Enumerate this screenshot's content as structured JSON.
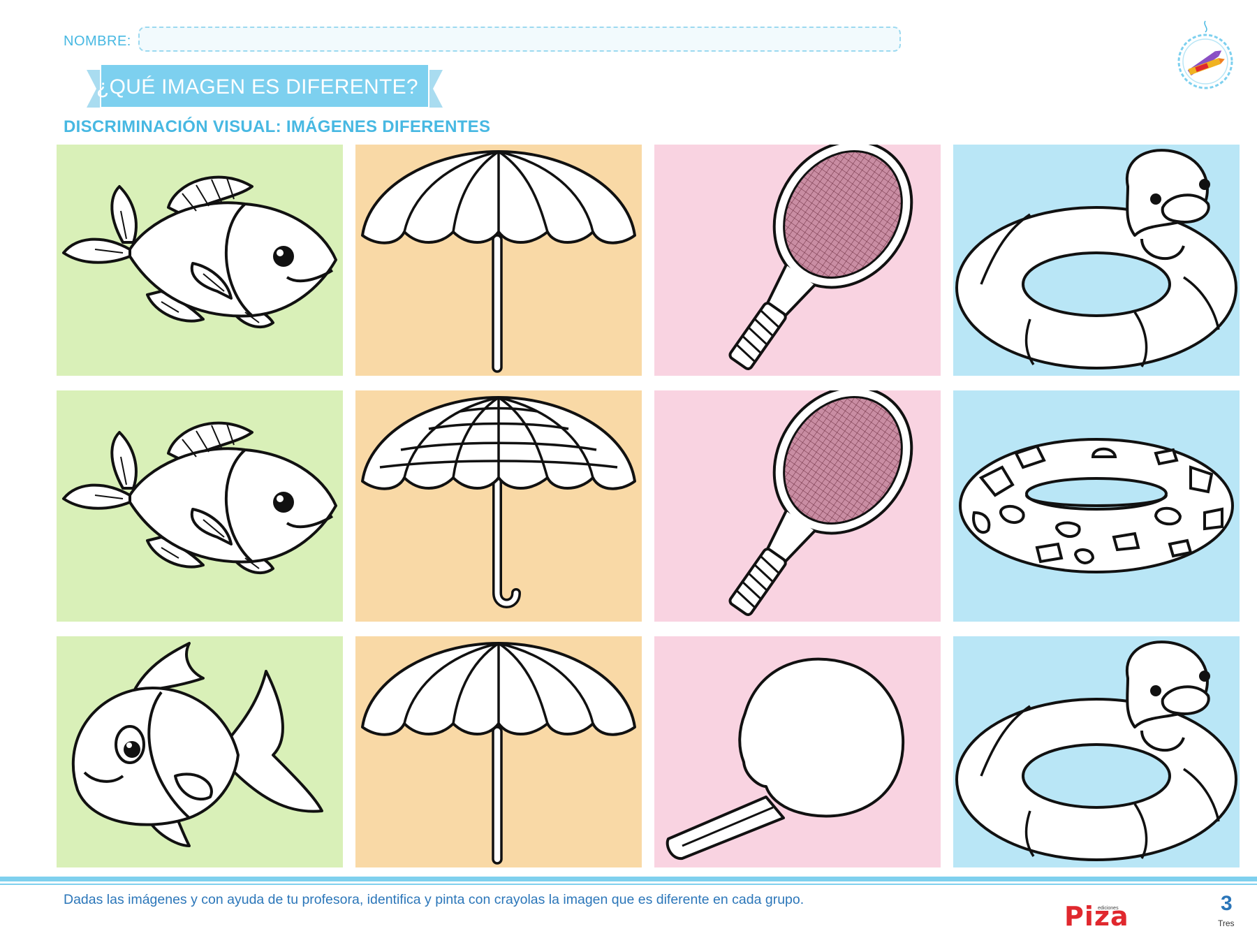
{
  "header": {
    "name_label": "NOMBRE:",
    "title": "¿QUÉ IMAGEN ES DIFERENTE?",
    "subtitle": "DISCRIMINACIÓN VISUAL: IMÁGENES DIFERENTES",
    "badge_icon": "crayon-icon"
  },
  "grid": {
    "rows": [
      [
        "fish-right",
        "umbrella-plain",
        "tennis-racket",
        "duck-float"
      ],
      [
        "fish-right",
        "umbrella-striped",
        "tennis-racket",
        "spotted-float"
      ],
      [
        "fish-left",
        "umbrella-plain",
        "pingpong-paddle",
        "duck-float"
      ]
    ],
    "column_colors": [
      "#d9f0b8",
      "#f9d9a6",
      "#f9d3e1",
      "#b9e6f6"
    ]
  },
  "footer": {
    "instruction": "Dadas las imágenes y con ayuda de tu profesora, identifica y pinta con crayolas la imagen que es diferente en cada grupo.",
    "brand_small": "ediciones",
    "brand": "Piza",
    "page_number": "3",
    "page_word": "Tres"
  },
  "colors": {
    "accent": "#47b8e2",
    "instruction": "#2b76b9",
    "brand": "#e0282e"
  }
}
